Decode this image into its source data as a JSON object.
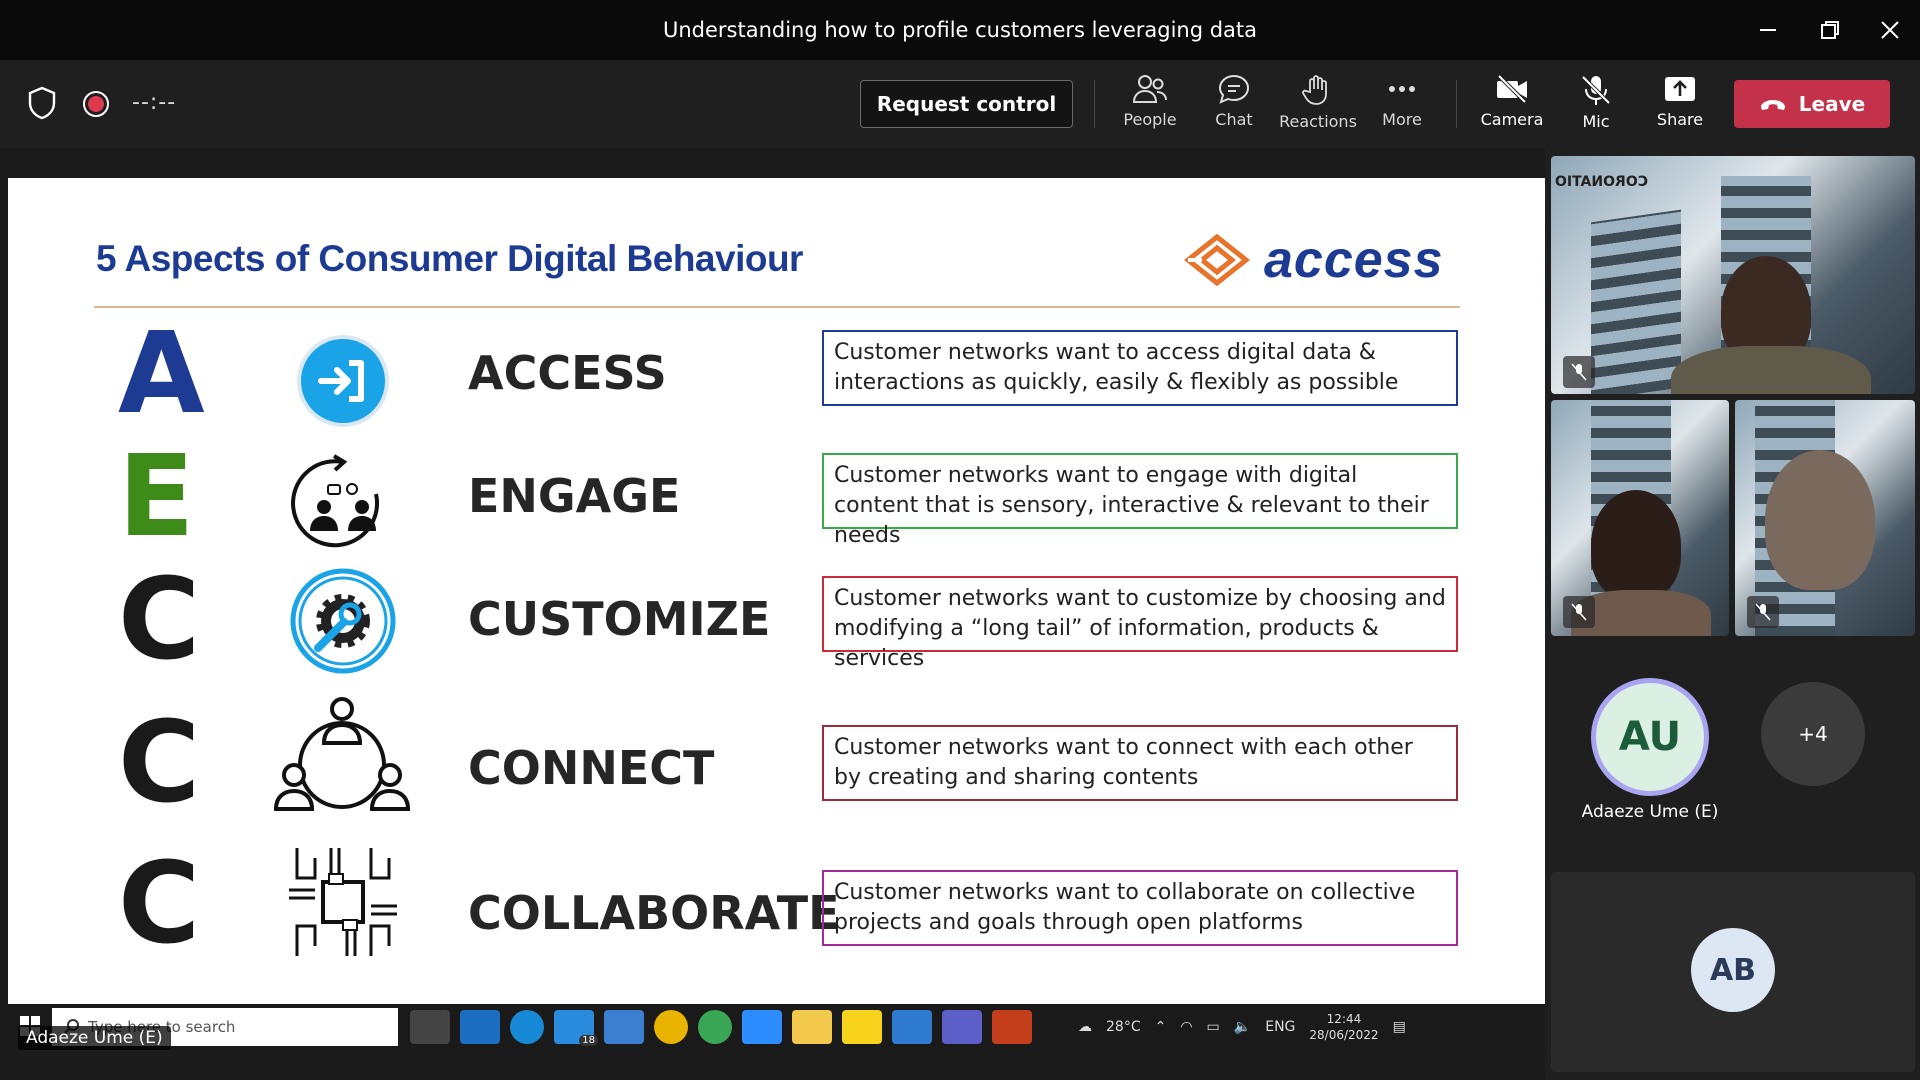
{
  "window": {
    "title": "Understanding how to profile customers leveraging data"
  },
  "toolbar": {
    "timer": "--:--",
    "request_control": "Request control",
    "items": [
      {
        "label": "People",
        "icon": "people-icon"
      },
      {
        "label": "Chat",
        "icon": "chat-icon"
      },
      {
        "label": "Reactions",
        "icon": "reactions-icon"
      },
      {
        "label": "More",
        "icon": "more-icon"
      },
      {
        "label": "Camera",
        "icon": "camera-off-icon"
      },
      {
        "label": "Mic",
        "icon": "mic-off-icon"
      },
      {
        "label": "Share",
        "icon": "share-icon"
      }
    ],
    "leave": "Leave",
    "leave_color": "#c4314b"
  },
  "slide": {
    "title": "5 Aspects of Consumer Digital Behaviour",
    "logo_text": "access",
    "brand_color": "#1d3b93",
    "aspects": [
      {
        "letter": "A",
        "name": "ACCESS",
        "desc": "Customer networks want to access digital data & interactions as quickly, easily & flexibly as possible",
        "color": "#1d3b93",
        "border": "#1d3b93",
        "icon": "enter-arrow-icon"
      },
      {
        "letter": "E",
        "name": "ENGAGE",
        "desc": "Customer networks want to engage with digital content that is sensory, interactive & relevant to their needs",
        "color": "#3f8b1a",
        "border": "#3aa94a",
        "icon": "engage-people-icon"
      },
      {
        "letter": "C",
        "name": "CUSTOMIZE",
        "desc": "Customer networks want to customize by choosing and modifying a “long tail” of information, products & services",
        "color": "#1a1a1a",
        "border": "#cc2a3a",
        "icon": "gear-wrench-icon"
      },
      {
        "letter": "C",
        "name": "CONNECT",
        "desc": "Customer networks want to connect with each other by creating and sharing contents",
        "color": "#1a1a1a",
        "border": "#a12a3a",
        "icon": "network-people-icon"
      },
      {
        "letter": "C",
        "name": "COLLABORATE",
        "desc": "Customer networks want to collaborate on collective projects and goals through open platforms",
        "color": "#1a1a1a",
        "border": "#a22a9a",
        "icon": "collaborate-hands-icon"
      }
    ]
  },
  "taskbar": {
    "search_placeholder": "Type here to search",
    "mail_badge": "18",
    "weather": "28°C",
    "lang": "ENG",
    "time": "12:44",
    "date": "28/06/2022"
  },
  "presenter_name": "Adaeze Ume (E)",
  "participants": {
    "tile1_caption": "CORONATIO",
    "au_initials": "AU",
    "au_name": "Adaeze Ume (E)",
    "overflow": "+4",
    "ab_initials": "AB"
  }
}
